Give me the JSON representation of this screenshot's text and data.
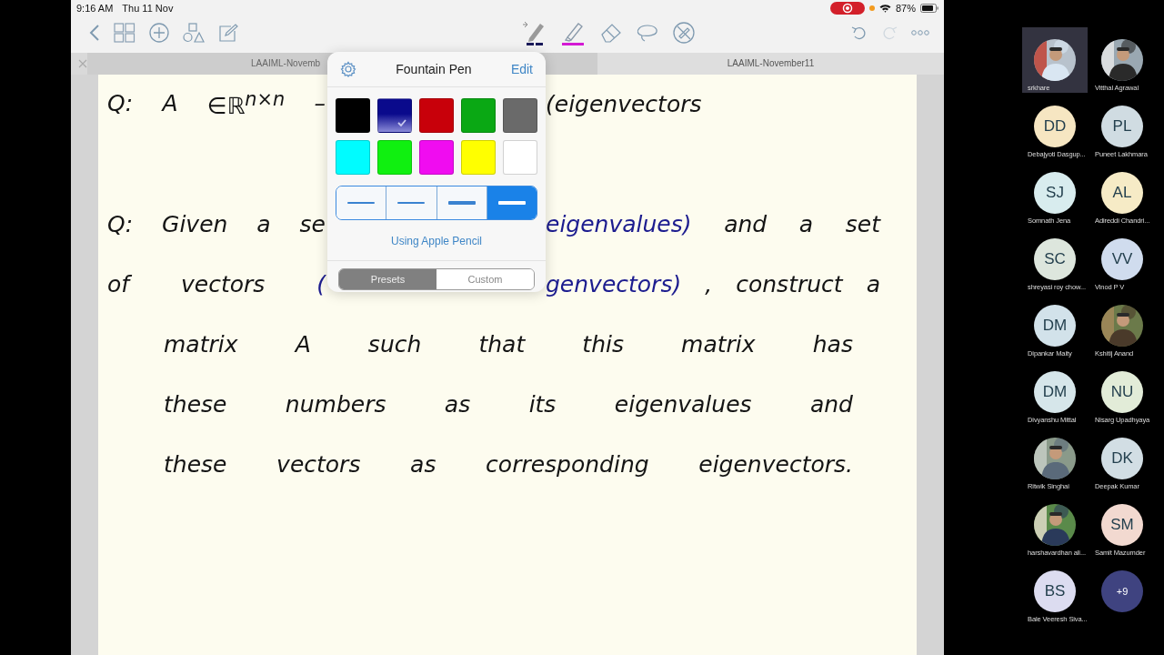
{
  "status_bar": {
    "time": "9:16 AM",
    "date": "Thu 11 Nov",
    "recording": true,
    "battery": "87%"
  },
  "toolbar": {
    "redo_disabled": true
  },
  "tabs": [
    {
      "title": "LAAIML-Novemb",
      "selected": false
    },
    {
      "title": "LAAIML-November11",
      "selected": true
    }
  ],
  "note": {
    "questions": [
      {
        "lines": [
          {
            "left": [
              {
                "text": "Q:",
                "color": "#141414"
              },
              {
                "text": "A",
                "color": "#141414"
              },
              {
                "text": "∈ℝ$^{n×n}$",
                "color": "#141414"
              },
              {
                "text": "–",
                "color": "#141414"
              }
            ],
            "right": [
              {
                "text": "(eigenvectors",
                "color": "#141414"
              }
            ]
          }
        ]
      },
      {
        "lines": [
          {
            "left": [
              {
                "text": "Q:",
                "color": "#141414"
              },
              {
                "text": "Given",
                "color": "#141414"
              },
              {
                "text": "a",
                "color": "#141414"
              },
              {
                "text": "se",
                "color": "#141414"
              }
            ],
            "right": [
              {
                "text": "eigenvalues)",
                "color": "#1c1c8f"
              },
              {
                "text": "and",
                "color": "#141414"
              },
              {
                "text": "a",
                "color": "#141414"
              },
              {
                "text": "set",
                "color": "#141414"
              }
            ]
          },
          {
            "left": [
              {
                "text": "of",
                "color": "#141414"
              },
              {
                "text": "vectors",
                "color": "#141414"
              },
              {
                "text": "(",
                "color": "#1c1c8f"
              }
            ],
            "right": [
              {
                "text": "genvectors)",
                "color": "#1c1c8f"
              },
              {
                "text": ",",
                "color": "#141414"
              },
              {
                "text": "construct",
                "color": "#141414"
              },
              {
                "text": "a",
                "color": "#141414"
              }
            ]
          },
          {
            "left": [
              {
                "text": "matrix",
                "color": "#141414"
              },
              {
                "text": "A",
                "color": "#141414"
              },
              {
                "text": "such",
                "color": "#141414"
              },
              {
                "text": "that",
                "color": "#141414"
              },
              {
                "text": "this",
                "color": "#141414"
              },
              {
                "text": "matrix",
                "color": "#141414"
              },
              {
                "text": "has",
                "color": "#141414"
              }
            ]
          },
          {
            "left": [
              {
                "text": "these",
                "color": "#141414"
              },
              {
                "text": "numbers",
                "color": "#141414"
              },
              {
                "text": "as",
                "color": "#141414"
              },
              {
                "text": "its",
                "color": "#141414"
              },
              {
                "text": "eigenvalues",
                "color": "#141414"
              },
              {
                "text": "and",
                "color": "#141414"
              }
            ]
          },
          {
            "left": [
              {
                "text": "these",
                "color": "#141414"
              },
              {
                "text": "vectors",
                "color": "#141414"
              },
              {
                "text": "as",
                "color": "#141414"
              },
              {
                "text": "corresponding",
                "color": "#141414"
              },
              {
                "text": "eigenvectors.",
                "color": "#141414"
              }
            ]
          }
        ]
      }
    ]
  },
  "pen_popup": {
    "title": "Fountain Pen",
    "edit": "Edit",
    "swatches": [
      {
        "color": "#000000",
        "selected": false
      },
      {
        "color": "#0a0a8c",
        "selected": true
      },
      {
        "color": "#c8000a",
        "selected": false
      },
      {
        "color": "#0aa814",
        "selected": false
      },
      {
        "color": "#6a6a6a",
        "selected": false
      },
      {
        "color": "#00fcff",
        "selected": false
      },
      {
        "color": "#10f010",
        "selected": false
      },
      {
        "color": "#f00cf0",
        "selected": false
      },
      {
        "color": "#ffff00",
        "selected": false
      },
      {
        "color": "#ffffff",
        "selected": false
      }
    ],
    "thicknesses": [
      {
        "selected": false
      },
      {
        "selected": false
      },
      {
        "selected": false
      },
      {
        "selected": true
      }
    ],
    "pencil_link": "Using Apple Pencil",
    "segments": [
      {
        "label": "Presets",
        "selected": true
      },
      {
        "label": "Custom",
        "selected": false
      }
    ]
  },
  "participants": [
    {
      "kind": "picture",
      "name": "srkhare",
      "selected": true
    },
    {
      "kind": "picture",
      "name": "Vitthal Agrawal",
      "selected": false
    },
    {
      "kind": "initials",
      "initials": "DD",
      "name": "Debajyoti Dasgup...",
      "color": "#f6e6c2",
      "selected": false
    },
    {
      "kind": "initials",
      "initials": "PL",
      "name": "Puneet Lakhmara",
      "color": "#d0dce2",
      "selected": false
    },
    {
      "kind": "initials",
      "initials": "SJ",
      "name": "Somnath Jena",
      "color": "#d8ecee",
      "selected": false
    },
    {
      "kind": "initials",
      "initials": "AL",
      "name": "Adireddi Chandri...",
      "color": "#f6ebc6",
      "selected": false
    },
    {
      "kind": "initials",
      "initials": "SC",
      "name": "shreyasi roy chow...",
      "color": "#dde6dd",
      "selected": false
    },
    {
      "kind": "initials",
      "initials": "VV",
      "name": "Vinod P V",
      "color": "#d0dcee",
      "selected": false
    },
    {
      "kind": "initials",
      "initials": "DM",
      "name": "Dipankar Maity",
      "color": "#d2e2ea",
      "selected": false
    },
    {
      "kind": "picture",
      "name": "Kshitij  Anand",
      "selected": false
    },
    {
      "kind": "initials",
      "initials": "DM",
      "name": "Divyanshu Mittal",
      "color": "#d6e6ea",
      "selected": false
    },
    {
      "kind": "initials",
      "initials": "NU",
      "name": "Nisarg Upadhyaya",
      "color": "#e2ecd8",
      "selected": false
    },
    {
      "kind": "picture",
      "name": "Ritwik Singhai",
      "selected": false
    },
    {
      "kind": "initials",
      "initials": "DK",
      "name": "Deepak Kumar",
      "color": "#d2dee4",
      "selected": false
    },
    {
      "kind": "picture",
      "name": "harshavardhan ali...",
      "selected": false
    },
    {
      "kind": "initials",
      "initials": "SM",
      "name": "Samit Mazumder",
      "color": "#f2d9d0",
      "selected": false
    },
    {
      "kind": "initials",
      "initials": "BS",
      "name": "Bale Veeresh Siva...",
      "color": "#dcdcf0",
      "selected": false
    },
    {
      "kind": "more",
      "initials": "+9",
      "color": "#3f4380",
      "selected": false
    }
  ]
}
